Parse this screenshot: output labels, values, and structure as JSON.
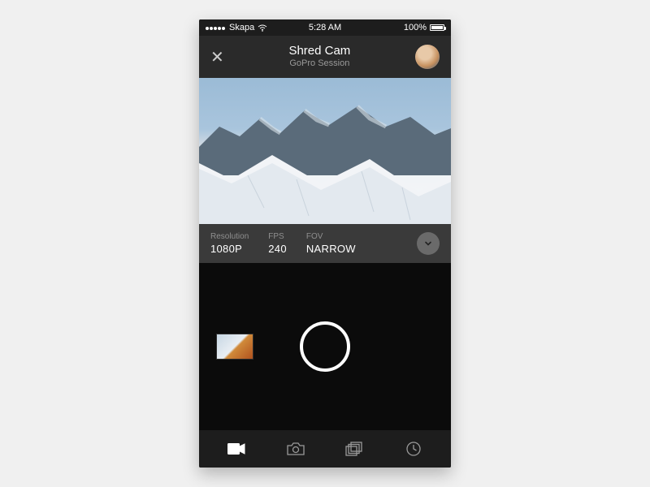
{
  "statusbar": {
    "carrier": "Skapa",
    "time": "5:28 AM",
    "battery_pct": "100%"
  },
  "header": {
    "title": "Shred Cam",
    "subtitle": "GoPro Session"
  },
  "settings": {
    "resolution": {
      "label": "Resolution",
      "value": "1080P"
    },
    "fps": {
      "label": "FPS",
      "value": "240"
    },
    "fov": {
      "label": "FOV",
      "value": "NARROW"
    }
  },
  "icons": {
    "close": "close-icon",
    "avatar": "avatar",
    "expand": "chevron-down-icon",
    "thumbnail": "last-capture-thumbnail",
    "shutter": "shutter-button",
    "nav_video": "video-mode-icon",
    "nav_photo": "photo-mode-icon",
    "nav_burst": "burst-mode-icon",
    "nav_timelapse": "timelapse-mode-icon"
  }
}
